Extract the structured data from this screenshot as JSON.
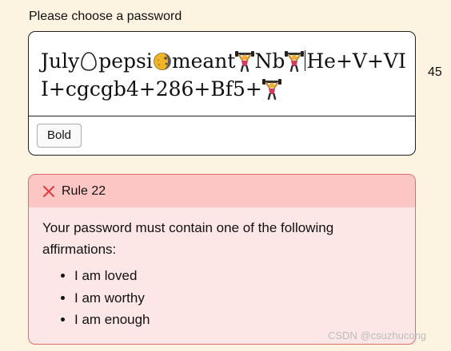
{
  "prompt": {
    "label": "Please choose a password"
  },
  "password": {
    "segments": [
      {
        "type": "text",
        "value": "July"
      },
      {
        "type": "emoji",
        "icon": "egg-icon"
      },
      {
        "type": "text",
        "value": "pepsi"
      },
      {
        "type": "emoji",
        "icon": "moon-icon"
      },
      {
        "type": "text",
        "value": "meant"
      },
      {
        "type": "emoji",
        "icon": "weightlifter-icon"
      },
      {
        "type": "text",
        "value": "Nb"
      },
      {
        "type": "emoji",
        "icon": "weightlifter-icon"
      },
      {
        "type": "caret"
      },
      {
        "type": "text",
        "value": "He+V+VII+cgcgb4+286+Bf5+"
      },
      {
        "type": "emoji",
        "icon": "weightlifter-icon"
      }
    ],
    "bold_button_label": "Bold",
    "char_count": "45"
  },
  "rule": {
    "title": "Rule 22",
    "status": "failed",
    "description": "Your password must contain one of the following affirmations:",
    "options": [
      "I am loved",
      "I am worthy",
      "I am enough"
    ]
  },
  "watermark": {
    "text": "CSDN @csuzhucong"
  },
  "colors": {
    "page_background": "#fdf3e1",
    "rule_header": "#fbc6c4",
    "rule_body": "#fde7e6",
    "rule_border": "#e06b6b",
    "error_icon": "#e23b3b"
  }
}
